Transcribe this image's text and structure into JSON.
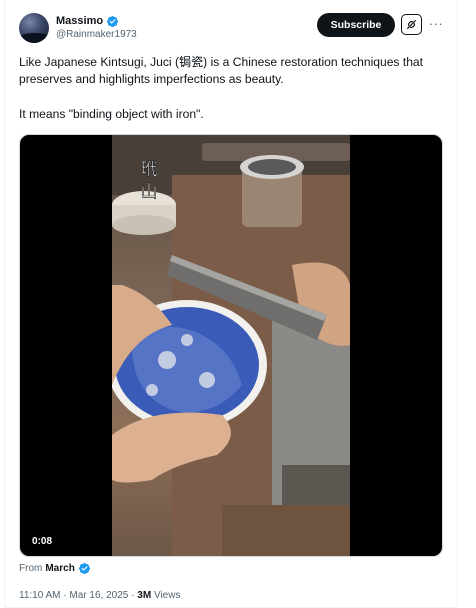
{
  "author": {
    "display_name": "Massimo",
    "handle": "@Rainmaker1973"
  },
  "actions": {
    "subscribe_label": "Subscribe",
    "grok_icon": "grok-icon",
    "more_label": "···"
  },
  "tweet": {
    "text_line1": "Like Japanese Kintsugi, Juci (锔瓷) is a Chinese restoration techniques that preserves and highlights imperfections as beauty.",
    "text_line2": "It means \"binding object with iron\"."
  },
  "video": {
    "watermark": "玳山",
    "timestamp": "0:08"
  },
  "attribution": {
    "prefix": "From",
    "source": "March"
  },
  "meta": {
    "time": "11:10 AM",
    "separator": "·",
    "date": "Mar 16, 2025",
    "views_count": "3M",
    "views_label": "Views"
  },
  "colors": {
    "verified_blue": "#1d9bf0",
    "text_primary": "#0f1419",
    "text_secondary": "#536471"
  }
}
